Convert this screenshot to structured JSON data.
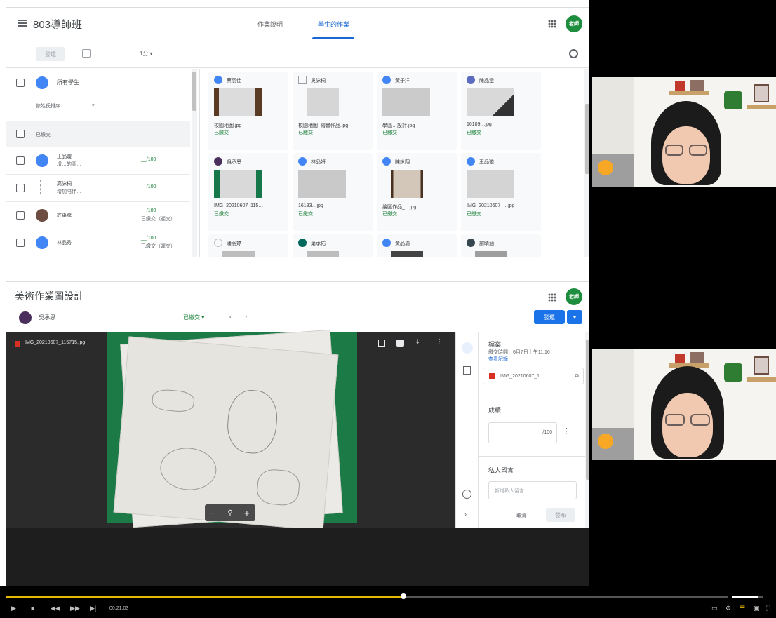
{
  "top_panel": {
    "class_title": "803導師班",
    "tabs": [
      {
        "label": "作業說明",
        "active": false
      },
      {
        "label": "學生的作業",
        "active": true
      }
    ],
    "avatar_text": "老師",
    "toolbar": {
      "return_label": "發還",
      "points_label": "1分 ▾"
    },
    "sidebar": {
      "all_students": "所有學生",
      "sort_label": "依姓氏排序",
      "submitted_header": "已繳交",
      "students": [
        {
          "name": "王品璇",
          "note": "增…的圖…",
          "status": "__/100"
        },
        {
          "name": "高詠桐",
          "note": "增加陪伴…",
          "status": "__/100"
        },
        {
          "name": "許禹騰",
          "note": "",
          "status": "__/100",
          "sub": "已繳交（遲交）"
        },
        {
          "name": "林品秀",
          "note": "",
          "status": "__/100",
          "sub": "已繳交（遲交）"
        }
      ]
    },
    "cards": [
      {
        "who": "蔡羽佳",
        "file": "校園地圖.jpg",
        "status": "已繳交"
      },
      {
        "who": "吳詠桐",
        "file": "校園地圖_繪畫作品.jpg",
        "status": "已繳交"
      },
      {
        "who": "黃子洋",
        "file": "學區…設計.jpg",
        "status": "已繳交"
      },
      {
        "who": "陳品澄",
        "file": "16109…jpg",
        "status": "已繳交"
      },
      {
        "who": "吳承恩",
        "file": "IMG_20210607_115…",
        "status": "已繳交"
      },
      {
        "who": "林品妍",
        "file": "16183…jpg",
        "status": "已繳交"
      },
      {
        "who": "陳詠翔",
        "file": "繪圖作品_…jpg",
        "status": "已繳交"
      },
      {
        "who": "王品璇",
        "file": "IMG_20210607_…jpg",
        "status": "已繳交"
      },
      {
        "who": "潘羽婷",
        "file": "",
        "status": ""
      },
      {
        "who": "葉承佑",
        "file": "",
        "status": ""
      },
      {
        "who": "黃品瑜",
        "file": "",
        "status": ""
      },
      {
        "who": "謝晴涵",
        "file": "",
        "status": ""
      }
    ]
  },
  "bottom_panel": {
    "assignment_title": "美術作業圖設計",
    "student_name": "吳承恩",
    "status": "已繳交 ▾",
    "return_label": "發還",
    "file_name": "IMG_20210607_115715.jpg",
    "zoom": {
      "minus": "−",
      "search": "🔍",
      "plus": "+"
    },
    "side": {
      "files_title": "檔案",
      "submitted_time": "繳交時間：6月7日上午11:16",
      "history_link": "查看記錄",
      "attached_file": "IMG_20210607_1…",
      "grade_title": "成績",
      "grade_value": "/100",
      "private_comment_title": "私人留言",
      "private_comment_placeholder": "新增私人留言…",
      "cancel_label": "取消",
      "post_label": "發布"
    }
  },
  "player": {
    "timecode": "00:21:03",
    "progress": 0.55,
    "volume": 0.85
  }
}
